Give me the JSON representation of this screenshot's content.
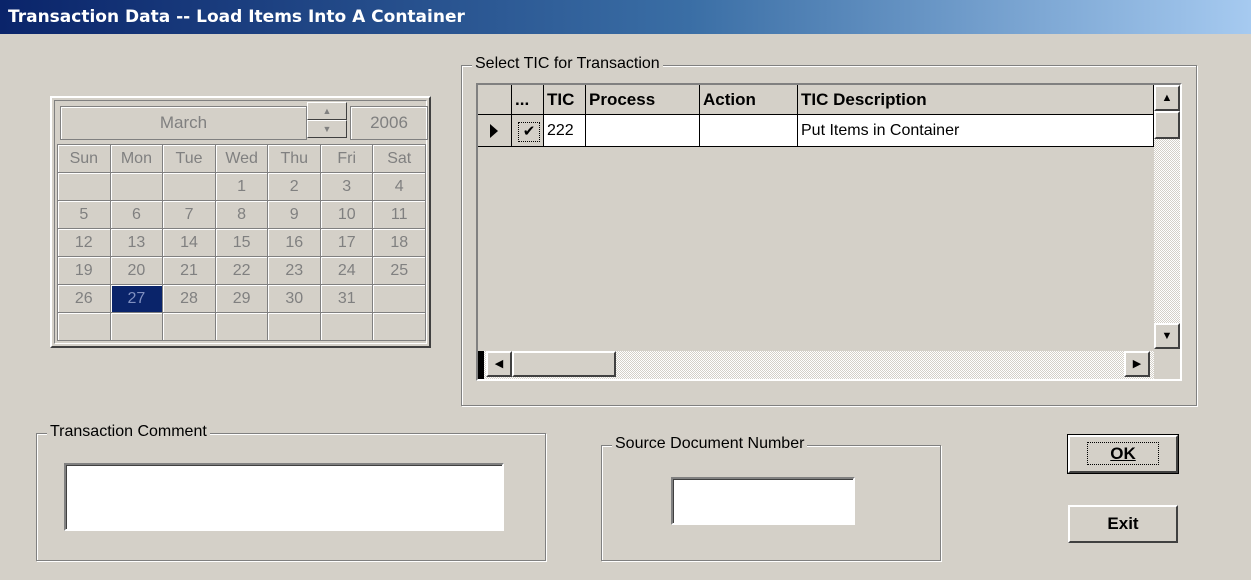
{
  "window": {
    "title": "Transaction Data -- Load Items Into A Container"
  },
  "calendar": {
    "month": "March",
    "year": "2006",
    "weekdays": [
      "Sun",
      "Mon",
      "Tue",
      "Wed",
      "Thu",
      "Fri",
      "Sat"
    ],
    "weeks": [
      [
        "",
        "",
        "",
        "1",
        "2",
        "3",
        "4"
      ],
      [
        "5",
        "6",
        "7",
        "8",
        "9",
        "10",
        "11"
      ],
      [
        "12",
        "13",
        "14",
        "15",
        "16",
        "17",
        "18"
      ],
      [
        "19",
        "20",
        "21",
        "22",
        "23",
        "24",
        "25"
      ],
      [
        "26",
        "27",
        "28",
        "29",
        "30",
        "31",
        ""
      ],
      [
        "",
        "",
        "",
        "",
        "",
        "",
        ""
      ]
    ],
    "selected_day": "27"
  },
  "tic_group": {
    "legend": "Select TIC for Transaction",
    "columns": [
      "...",
      "TIC",
      "Process",
      "Action",
      "TIC Description"
    ],
    "rows": [
      {
        "check": "✔",
        "tic": "222",
        "process": "",
        "action": "",
        "description": "Put Items in Container"
      }
    ]
  },
  "comment": {
    "legend": "Transaction Comment",
    "value": ""
  },
  "source_doc": {
    "legend": "Source Document Number",
    "value": ""
  },
  "buttons": {
    "ok": "OK",
    "exit": "Exit"
  }
}
